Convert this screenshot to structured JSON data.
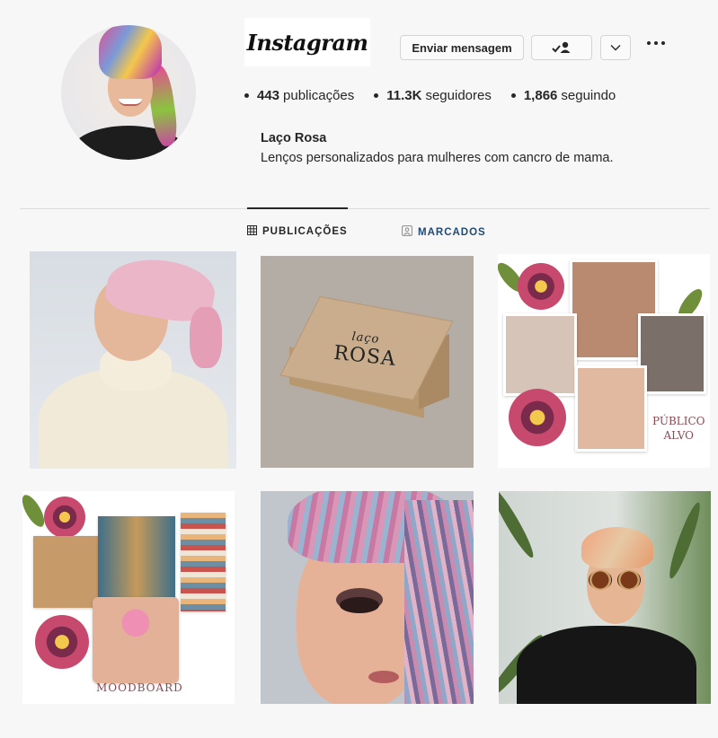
{
  "header": {
    "app_logo": "Instagram",
    "buttons": {
      "message": "Enviar mensagem",
      "follow_icon": "person-check-icon",
      "dropdown_icon": "chevron-down-icon",
      "more_icon": "more-horizontal-icon"
    }
  },
  "profile": {
    "stats": [
      {
        "value": "443",
        "label": "publicações"
      },
      {
        "value": "11.3K",
        "label": "seguidores"
      },
      {
        "value": "1,866",
        "label": "seguindo"
      }
    ],
    "name": "Laço Rosa",
    "bio": "Lenços personalizados para mulheres com cancro de mama."
  },
  "tabs": [
    {
      "label": "PUBLICAÇÕES",
      "icon": "grid-icon",
      "active": true
    },
    {
      "label": "MARCADOS",
      "icon": "tagged-icon",
      "active": false,
      "color": "#1f4a75"
    }
  ],
  "grid": {
    "posts": [
      {
        "subject": "woman in pink headscarf"
      },
      {
        "subject": "kraft box",
        "text_script": "laço",
        "text_main": "ROSA"
      },
      {
        "subject": "collage",
        "caption_line1": "PÚBLICO",
        "caption_line2": "ALVO"
      },
      {
        "subject": "moodboard",
        "caption": "MOODBOARD"
      },
      {
        "subject": "face with striped scarf"
      },
      {
        "subject": "woman with sunglasses and turban"
      }
    ]
  },
  "colors": {
    "background": "#f7f7f7",
    "text": "#262626",
    "tagged_tab": "#1f4a75"
  }
}
